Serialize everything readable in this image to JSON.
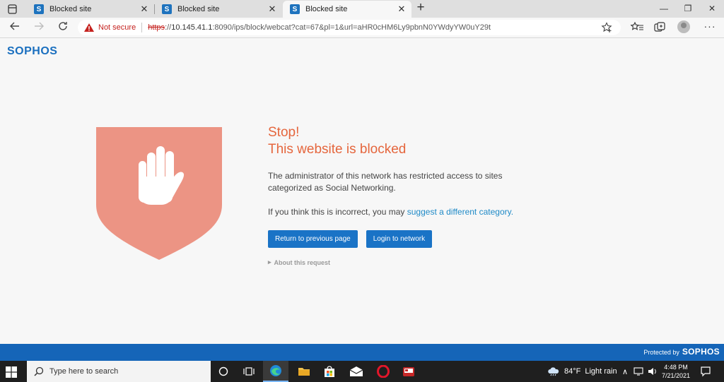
{
  "tabs": [
    {
      "label": "Blocked site",
      "favicon": "S"
    },
    {
      "label": "Blocked site",
      "favicon": "S"
    },
    {
      "label": "Blocked site",
      "favicon": "S"
    }
  ],
  "window_controls": {
    "minimize": "—",
    "restore": "❐",
    "close": "✕"
  },
  "nav": {
    "security_label": "Not secure",
    "url_scheme": "https",
    "url_sep": "://",
    "url_host": "10.145.41.1",
    "url_path": ":8090/ips/block/webcat?cat=67&pl=1&url=aHR0cHM6Ly9pbnN0YWdyYW0uY29t"
  },
  "page": {
    "logo": "SOPHOS",
    "title_line1": "Stop!",
    "title_line2": "This website is blocked",
    "message": "The administrator of this network has restricted access to sites categorized as Social Networking.",
    "incorrect_prefix": "If you think this is incorrect, you may ",
    "suggest_link": "suggest a different category",
    "suggest_suffix": ".",
    "return_button": "Return to previous page",
    "login_button": "Login to network",
    "about_request": "About this request",
    "footer_protected": "Protected by",
    "footer_brand": "SOPHOS"
  },
  "colors": {
    "title": "#e5663d",
    "shield": "#ec9484",
    "button": "#1a73c6",
    "link": "#1f8ac7",
    "footer": "#1565b8"
  },
  "taskbar": {
    "search_placeholder": "Type here to search",
    "weather_temp": "84°F",
    "weather_desc": "Light rain",
    "time": "4:48 PM",
    "date": "7/21/2021"
  }
}
